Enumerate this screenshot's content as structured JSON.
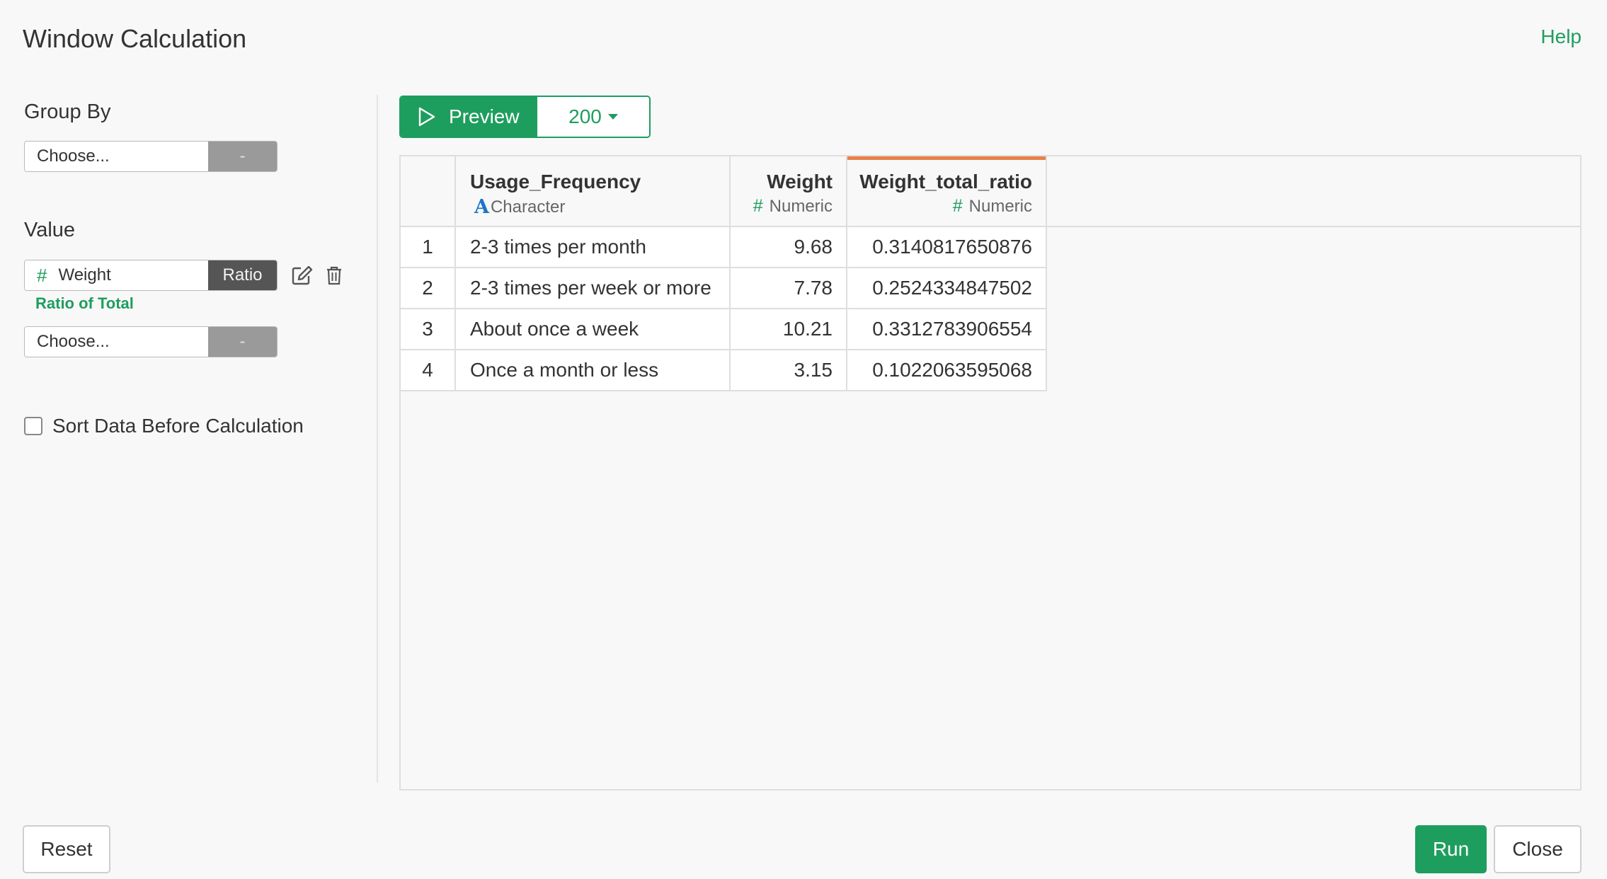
{
  "dialog": {
    "title": "Window Calculation",
    "help": "Help"
  },
  "group_by": {
    "label": "Group By",
    "placeholder": "Choose...",
    "button": "-"
  },
  "value": {
    "label": "Value",
    "column": "Weight",
    "column_type_icon": "#",
    "calc_button": "Ratio",
    "calc_description": "Ratio of Total",
    "edit_icon": "pencil-square-icon",
    "delete_icon": "trash-icon",
    "second": {
      "placeholder": "Choose...",
      "button": "-"
    }
  },
  "sort": {
    "label": "Sort Data Before Calculation",
    "checked": false
  },
  "preview": {
    "label": "Preview",
    "rows": "200"
  },
  "table": {
    "columns": [
      {
        "name": "Usage_Frequency",
        "type_icon": "A",
        "type": "Character"
      },
      {
        "name": "Weight",
        "type_icon": "#",
        "type": "Numeric"
      },
      {
        "name": "Weight_total_ratio",
        "type_icon": "#",
        "type": "Numeric"
      }
    ],
    "rows": [
      {
        "index": "1",
        "cells": [
          "2-3 times per month",
          "9.68",
          "0.3140817650876"
        ]
      },
      {
        "index": "2",
        "cells": [
          "2-3 times per week or more",
          "7.78",
          "0.2524334847502"
        ]
      },
      {
        "index": "3",
        "cells": [
          "About once a week",
          "10.21",
          "0.3312783906554"
        ]
      },
      {
        "index": "4",
        "cells": [
          "Once a month or less",
          "3.15",
          "0.1022063595068"
        ]
      }
    ]
  },
  "footer": {
    "reset": "Reset",
    "run": "Run",
    "close": "Close"
  },
  "colors": {
    "accent": "#1e9e5e",
    "new_column_marker": "#e8804a",
    "character_type": "#1b74c9"
  }
}
